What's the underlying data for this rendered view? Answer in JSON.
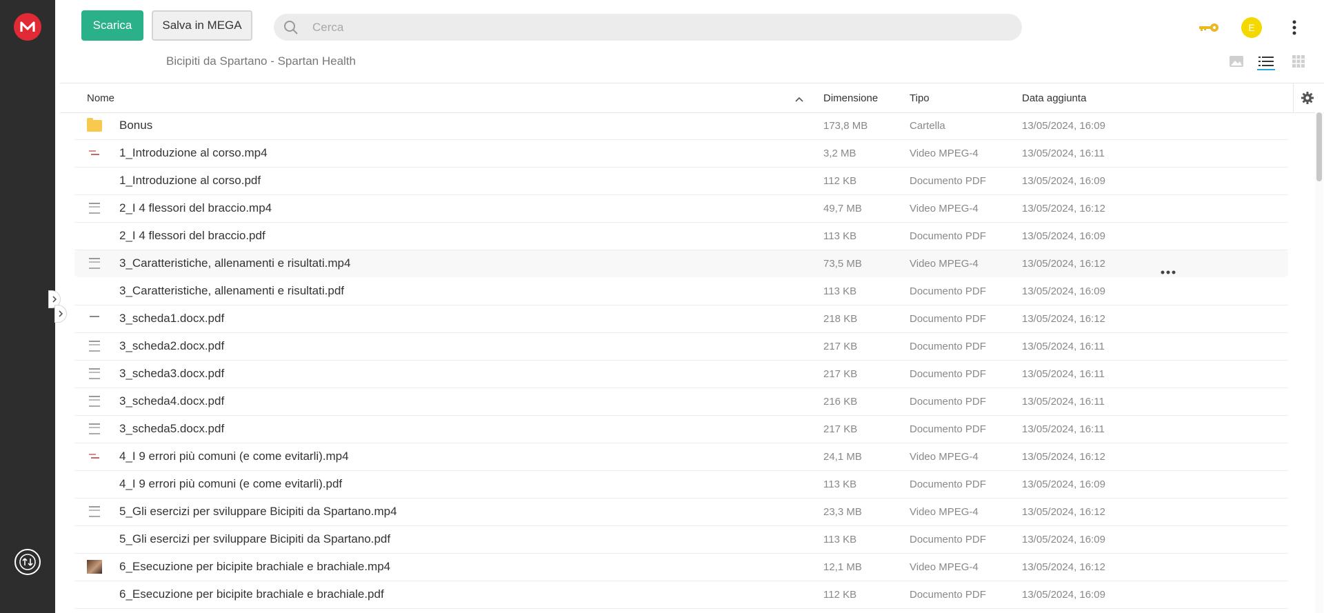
{
  "header": {
    "download_label": "Scarica",
    "save_label": "Salva in MEGA",
    "search_placeholder": "Cerca",
    "avatar_initial": "E",
    "breadcrumb": "Bicipiti da Spartano - Spartan Health"
  },
  "columns": {
    "name": "Nome",
    "size": "Dimensione",
    "type": "Tipo",
    "date": "Data aggiunta"
  },
  "files": [
    {
      "name": "Bonus",
      "size": "173,8 MB",
      "type": "Cartella",
      "date": "13/05/2024, 16:09",
      "thumb": "folder"
    },
    {
      "name": "1_Introduzione al corso.mp4",
      "size": "3,2 MB",
      "type": "Video MPEG-4",
      "date": "13/05/2024, 16:11",
      "thumb": "red"
    },
    {
      "name": "1_Introduzione al corso.pdf",
      "size": "112 KB",
      "type": "Documento PDF",
      "date": "13/05/2024, 16:09",
      "thumb": "none"
    },
    {
      "name": "2_I 4 flessori del braccio.mp4",
      "size": "49,7 MB",
      "type": "Video MPEG-4",
      "date": "13/05/2024, 16:12",
      "thumb": "doc"
    },
    {
      "name": "2_I 4 flessori del braccio.pdf",
      "size": "113 KB",
      "type": "Documento PDF",
      "date": "13/05/2024, 16:09",
      "thumb": "none"
    },
    {
      "name": "3_Caratteristiche, allenamenti e risultati.mp4",
      "size": "73,5 MB",
      "type": "Video MPEG-4",
      "date": "13/05/2024, 16:12",
      "thumb": "doc"
    },
    {
      "name": "3_Caratteristiche, allenamenti e risultati.pdf",
      "size": "113 KB",
      "type": "Documento PDF",
      "date": "13/05/2024, 16:09",
      "thumb": "none"
    },
    {
      "name": "3_scheda1.docx.pdf",
      "size": "218 KB",
      "type": "Documento PDF",
      "date": "13/05/2024, 16:12",
      "thumb": "dash"
    },
    {
      "name": "3_scheda2.docx.pdf",
      "size": "217 KB",
      "type": "Documento PDF",
      "date": "13/05/2024, 16:11",
      "thumb": "doc"
    },
    {
      "name": "3_scheda3.docx.pdf",
      "size": "217 KB",
      "type": "Documento PDF",
      "date": "13/05/2024, 16:11",
      "thumb": "doc"
    },
    {
      "name": "3_scheda4.docx.pdf",
      "size": "216 KB",
      "type": "Documento PDF",
      "date": "13/05/2024, 16:11",
      "thumb": "doc"
    },
    {
      "name": "3_scheda5.docx.pdf",
      "size": "217 KB",
      "type": "Documento PDF",
      "date": "13/05/2024, 16:11",
      "thumb": "doc"
    },
    {
      "name": "4_I 9 errori più comuni (e come evitarli).mp4",
      "size": "24,1 MB",
      "type": "Video MPEG-4",
      "date": "13/05/2024, 16:12",
      "thumb": "red"
    },
    {
      "name": "4_I 9 errori più comuni (e come evitarli).pdf",
      "size": "113 KB",
      "type": "Documento PDF",
      "date": "13/05/2024, 16:09",
      "thumb": "none"
    },
    {
      "name": "5_Gli esercizi per sviluppare Bicipiti da Spartano.mp4",
      "size": "23,3 MB",
      "type": "Video MPEG-4",
      "date": "13/05/2024, 16:12",
      "thumb": "doc"
    },
    {
      "name": "5_Gli esercizi per sviluppare Bicipiti da Spartano.pdf",
      "size": "113 KB",
      "type": "Documento PDF",
      "date": "13/05/2024, 16:09",
      "thumb": "none"
    },
    {
      "name": "6_Esecuzione per bicipite brachiale e brachiale.mp4",
      "size": "12,1 MB",
      "type": "Video MPEG-4",
      "date": "13/05/2024, 16:12",
      "thumb": "img"
    },
    {
      "name": "6_Esecuzione per bicipite brachiale e brachiale.pdf",
      "size": "112 KB",
      "type": "Documento PDF",
      "date": "13/05/2024, 16:09",
      "thumb": "none"
    }
  ],
  "highlighted_row": 5,
  "colors": {
    "accent_green": "#2ab189",
    "brand_red": "#e12a35",
    "avatar_yellow": "#f5d800",
    "key_gold": "#e8b923",
    "active_view_blue": "#2aa3d8"
  }
}
